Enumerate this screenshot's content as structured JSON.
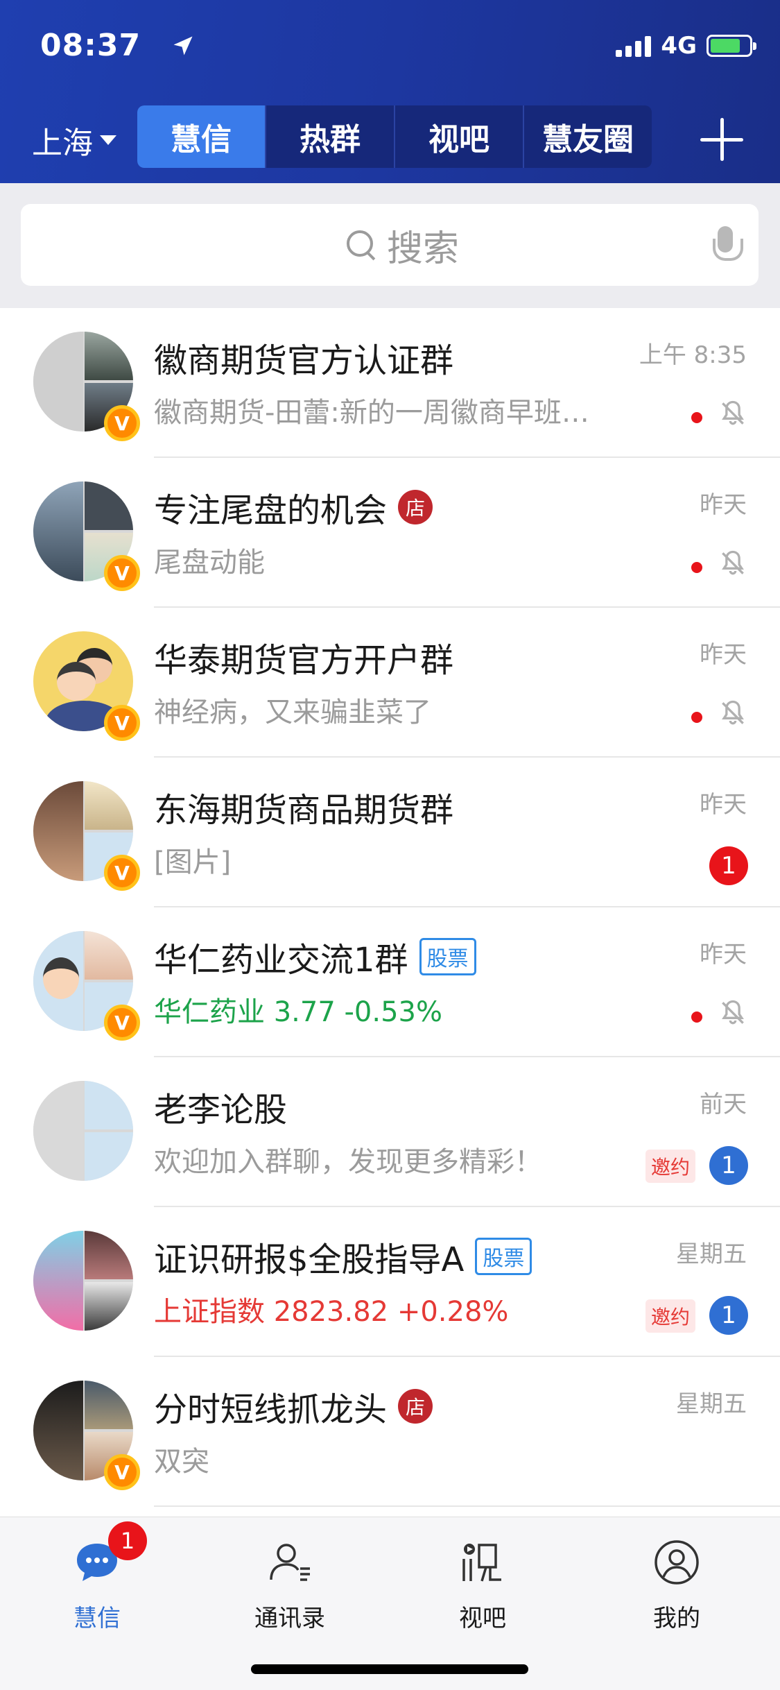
{
  "status_bar": {
    "time": "08:37",
    "network": "4G"
  },
  "header": {
    "city": "上海",
    "tabs": [
      {
        "label": "慧信",
        "active": true
      },
      {
        "label": "热群",
        "active": false
      },
      {
        "label": "视吧",
        "active": false
      },
      {
        "label": "慧友圈",
        "active": false
      }
    ],
    "accent_color": "#3a7bea"
  },
  "search": {
    "placeholder": "搜索"
  },
  "chats": [
    {
      "name": "徽商期货官方认证群",
      "preview": "徽商期货-田蕾:新的一周徽商早班…",
      "time": "上午 8:35",
      "tag": "",
      "tag_type": "",
      "verified": true,
      "unread_dot": true,
      "muted": true,
      "count": "",
      "invite": ""
    },
    {
      "name": "专注尾盘的机会",
      "preview": "尾盘动能",
      "time": "昨天",
      "tag": "店",
      "tag_type": "shop",
      "verified": true,
      "unread_dot": true,
      "muted": true,
      "count": "",
      "invite": ""
    },
    {
      "name": "华泰期货官方开户群",
      "preview": "神经病，又来骗韭菜了",
      "time": "昨天",
      "tag": "",
      "tag_type": "",
      "verified": true,
      "unread_dot": true,
      "muted": true,
      "count": "",
      "invite": ""
    },
    {
      "name": "东海期货商品期货群",
      "preview": "[图片]",
      "time": "昨天",
      "tag": "",
      "tag_type": "",
      "verified": true,
      "unread_dot": false,
      "muted": false,
      "count": "1",
      "count_color": "red",
      "invite": ""
    },
    {
      "name": "华仁药业交流1群",
      "preview": "华仁药业 3.77 -0.53%",
      "preview_color": "green",
      "time": "昨天",
      "tag": "股票",
      "tag_type": "stock",
      "verified": true,
      "unread_dot": true,
      "muted": true,
      "count": "",
      "invite": ""
    },
    {
      "name": "老李论股",
      "preview": "欢迎加入群聊，发现更多精彩！",
      "time": "前天",
      "tag": "",
      "tag_type": "",
      "verified": false,
      "unread_dot": false,
      "muted": false,
      "count": "1",
      "count_color": "blue",
      "invite": "邀约"
    },
    {
      "name": "证识研报$全股指导A",
      "preview": "上证指数 2823.82 +0.28%",
      "preview_color": "red",
      "time": "星期五",
      "tag": "股票",
      "tag_type": "stock",
      "verified": false,
      "unread_dot": false,
      "muted": false,
      "count": "1",
      "count_color": "blue",
      "invite": "邀约"
    },
    {
      "name": "分时短线抓龙头",
      "preview": "双突",
      "time": "星期五",
      "tag": "店",
      "tag_type": "shop",
      "verified": true,
      "unread_dot": false,
      "muted": false,
      "count": "",
      "invite": ""
    }
  ],
  "tabbar": {
    "items": [
      {
        "label": "慧信",
        "icon": "chat-bubble-icon",
        "active": true,
        "badge": "1"
      },
      {
        "label": "通讯录",
        "icon": "contacts-icon",
        "active": false,
        "badge": ""
      },
      {
        "label": "视吧",
        "icon": "video-bar-icon",
        "active": false,
        "badge": ""
      },
      {
        "label": "我的",
        "icon": "profile-icon",
        "active": false,
        "badge": ""
      }
    ]
  },
  "verified_badge_text": "V"
}
